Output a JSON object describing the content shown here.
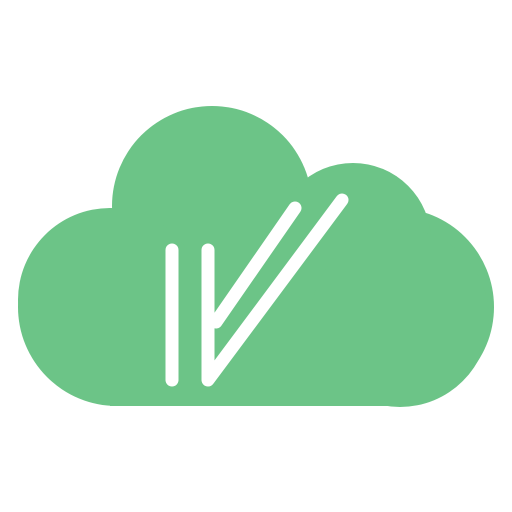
{
  "logo": {
    "icon": "cloud-check-logo-icon",
    "colors": {
      "background": "#ffffff",
      "cloud": "#6cc487",
      "mark": "#ffffff"
    }
  }
}
